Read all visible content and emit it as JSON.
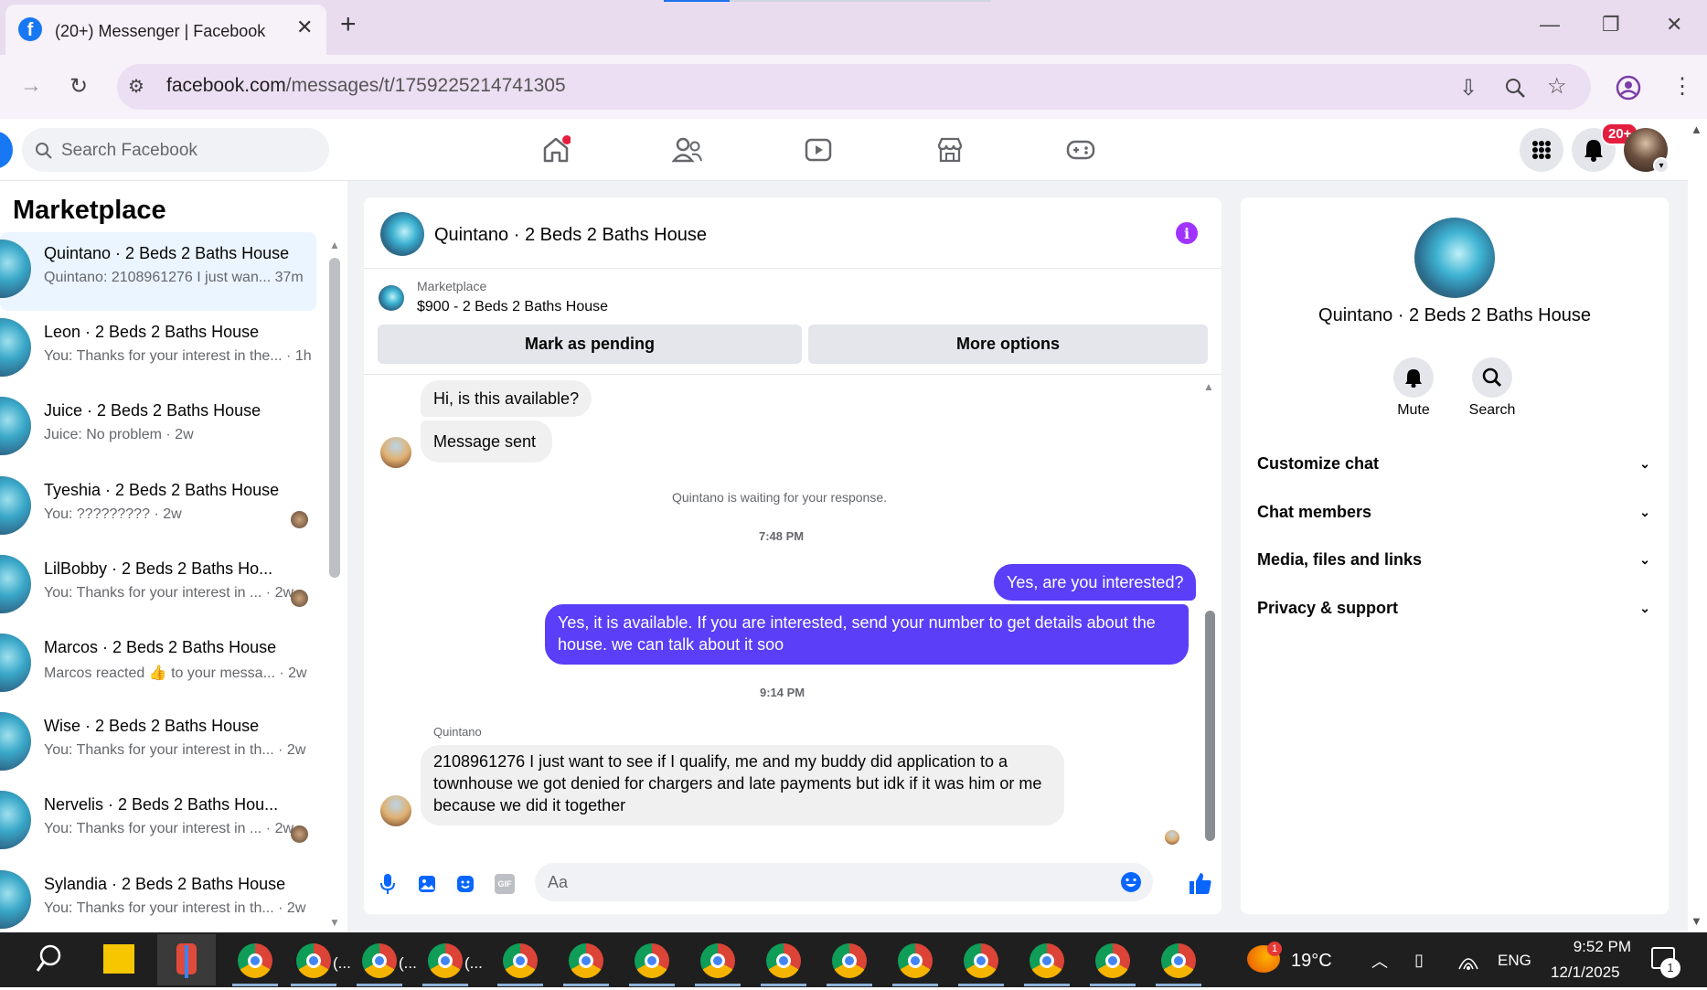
{
  "browser": {
    "tab_title": "(20+) Messenger | Facebook",
    "url_host": "facebook.com",
    "url_path": "/messages/t/1759225214741305"
  },
  "fb_nav": {
    "search_placeholder": "Search Facebook",
    "notif_badge": "20+",
    "nav_icons": [
      "home-icon",
      "friends-icon",
      "video-icon",
      "marketplace-icon",
      "gaming-icon"
    ]
  },
  "sidebar": {
    "title": "Marketplace",
    "conversations": [
      {
        "name": "Quintano · 2 Beds 2 Baths House",
        "preview": "Quintano: 2108961276 I just wan... 37m"
      },
      {
        "name": "Leon · 2 Beds 2 Baths House",
        "preview": "You: Thanks for your interest in the... · 1h"
      },
      {
        "name": "Juice · 2 Beds 2 Baths House",
        "preview": "Juice: No problem · 2w"
      },
      {
        "name": "Tyeshia · 2 Beds 2 Baths House",
        "preview": "You: ????????? · 2w"
      },
      {
        "name": "LilBobby · 2 Beds 2 Baths Ho...",
        "preview": "You: Thanks for your interest in ... · 2w"
      },
      {
        "name": "Marcos · 2 Beds 2 Baths House",
        "preview": "Marcos reacted 👍 to your messa... · 2w"
      },
      {
        "name": "Wise · 2 Beds 2 Baths House",
        "preview": "You: Thanks for your interest in th... · 2w"
      },
      {
        "name": "Nervelis · 2 Beds 2 Baths Hou...",
        "preview": "You: Thanks for your interest in ... · 2w"
      },
      {
        "name": "Sylandia · 2 Beds 2 Baths House",
        "preview": "You: Thanks for your interest in th... · 2w"
      }
    ]
  },
  "chat": {
    "title": "Quintano · 2 Beds 2 Baths House",
    "listing_label": "Marketplace",
    "listing_price": "$900 - 2 Beds 2 Baths House",
    "mark_pending": "Mark as pending",
    "more_options": "More options",
    "messages": {
      "in1": "Hi, is this available?",
      "in2": "Message sent",
      "waiting": "Quintano is waiting for your response.",
      "time1": "7:48 PM",
      "out1": "Yes, are you interested?",
      "out2": "Yes, it is available. If you are interested, send your number to get details about the house. we can talk about it soo",
      "time2": "9:14 PM",
      "sender": "Quintano",
      "in3": "2108961276 I just want to see if I qualify, me and my buddy did application to a townhouse we got denied for chargers and late payments but idk if it was him or me because we did it together"
    },
    "composer_placeholder": "Aa",
    "gif_label": "GIF"
  },
  "details": {
    "name": "Quintano · 2 Beds 2 Baths House",
    "mute": "Mute",
    "search": "Search",
    "sections": [
      "Customize chat",
      "Chat members",
      "Media, files and links",
      "Privacy & support"
    ]
  },
  "taskbar": {
    "weather": "19°C",
    "weather_badge": "1",
    "lang": "ENG",
    "time": "9:52 PM",
    "date": "12/1/2025",
    "notif_count": "1",
    "partial_label": "(..."
  },
  "colors": {
    "fb_blue": "#1877f2",
    "outgoing_bubble": "#5b3ef7",
    "info_purple": "#a033ff",
    "badge_red": "#e41e3f"
  }
}
